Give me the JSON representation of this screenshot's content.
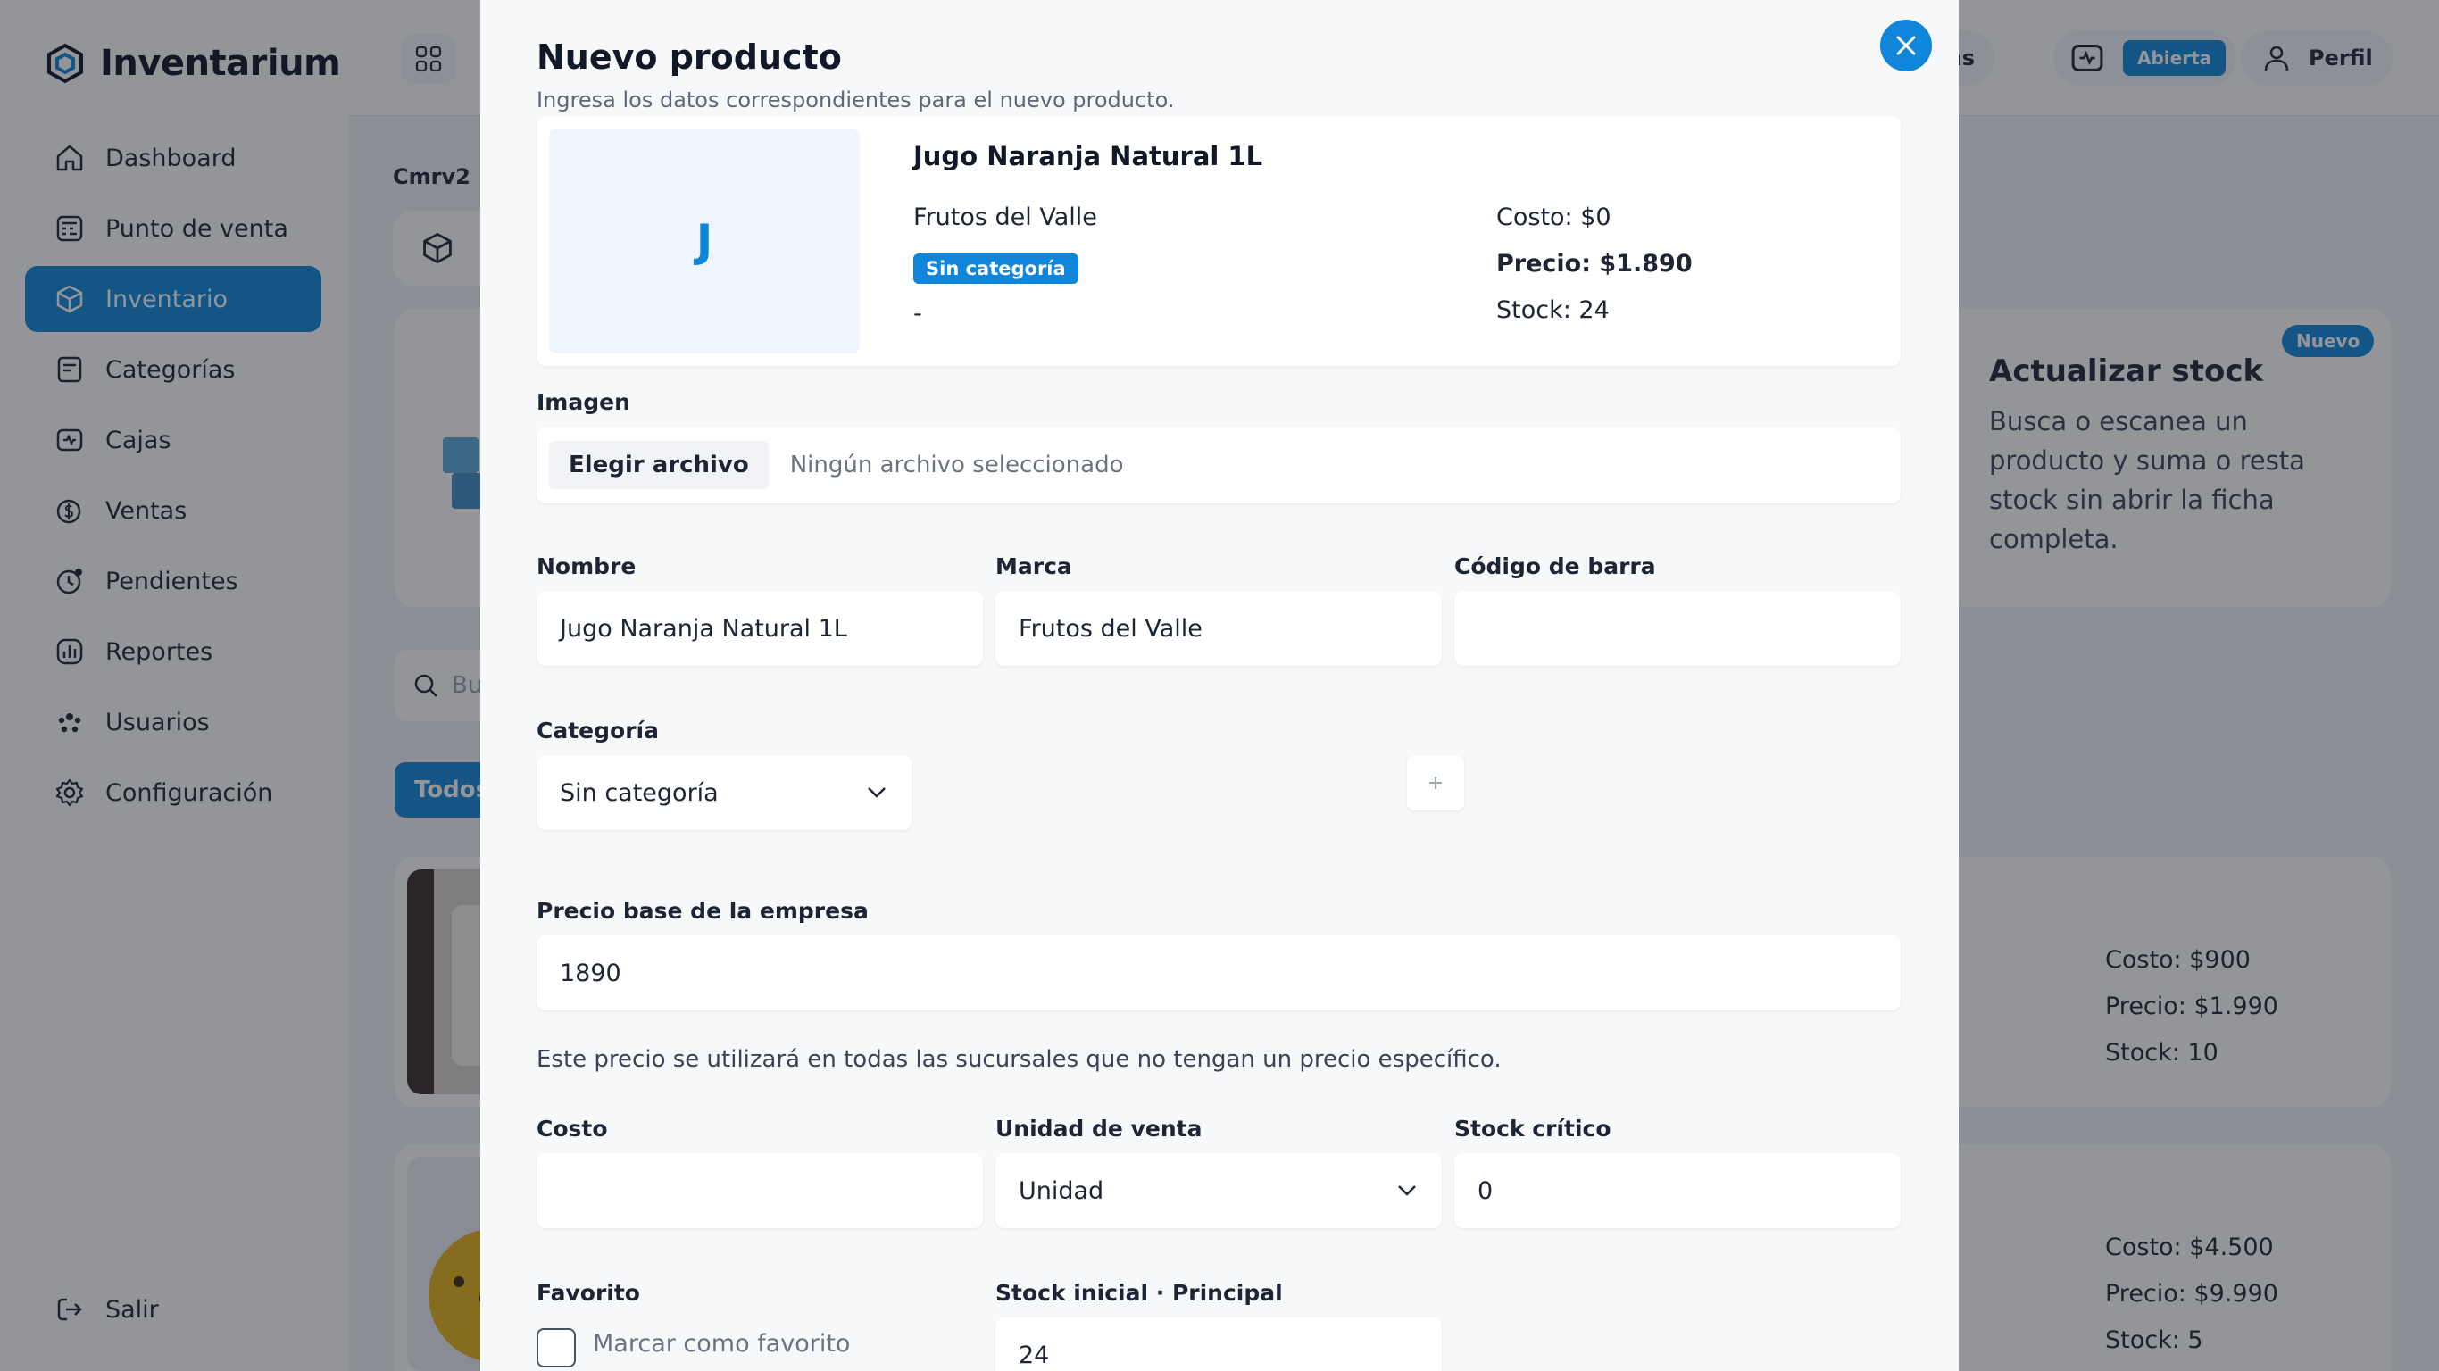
{
  "app": {
    "name": "Inventarium"
  },
  "sidebar": {
    "items": [
      {
        "label": "Dashboard",
        "icon": "home-icon"
      },
      {
        "label": "Punto de venta",
        "icon": "register-icon"
      },
      {
        "label": "Inventario",
        "icon": "box-icon",
        "active": true
      },
      {
        "label": "Categorías",
        "icon": "tag-icon"
      },
      {
        "label": "Cajas",
        "icon": "cash-box-icon"
      },
      {
        "label": "Ventas",
        "icon": "money-icon"
      },
      {
        "label": "Pendientes",
        "icon": "pending-icon"
      },
      {
        "label": "Reportes",
        "icon": "report-icon"
      },
      {
        "label": "Usuarios",
        "icon": "users-icon"
      },
      {
        "label": "Configuración",
        "icon": "gear-icon"
      }
    ],
    "logout": "Salir"
  },
  "topbar": {
    "alerts_label": "ertas",
    "cash_status": "Abierta",
    "profile_label": "Perfil"
  },
  "background": {
    "breadcrumb": "Cmrv2",
    "search_placeholder": "Bu",
    "tab_all": "Todos",
    "promo": {
      "badge": "Nuevo",
      "title": "Actualizar stock",
      "text": "Busca o escanea un producto y suma o resta stock sin abrir la ficha completa."
    },
    "products": [
      {
        "cost": "Costo: $900",
        "price": "Precio: $1.990",
        "stock": "Stock: 10"
      },
      {
        "cost": "Costo: $4.500",
        "price": "Precio: $9.990",
        "stock": "Stock: 5"
      }
    ]
  },
  "modal": {
    "title": "Nuevo producto",
    "subtitle": "Ingresa los datos correspondientes para el nuevo producto.",
    "preview": {
      "initial": "J",
      "name": "Jugo Naranja Natural 1L",
      "brand": "Frutos del Valle",
      "category": "Sin categoría",
      "dash": "-",
      "cost": "Costo: $0",
      "price": "Precio: $1.890",
      "stock": "Stock: 24"
    },
    "image": {
      "label": "Imagen",
      "button": "Elegir archivo",
      "status": "Ningún archivo seleccionado"
    },
    "name": {
      "label": "Nombre",
      "value": "Jugo Naranja Natural 1L"
    },
    "brand": {
      "label": "Marca",
      "value": "Frutos del Valle"
    },
    "barcode": {
      "label": "Código de barra",
      "value": ""
    },
    "category": {
      "label": "Categoría",
      "value": "Sin categoría",
      "add": "+"
    },
    "base_price": {
      "label": "Precio base de la empresa",
      "value": "1890",
      "help": "Este precio se utilizará en todas las sucursales que no tengan un precio específico."
    },
    "cost": {
      "label": "Costo",
      "value": ""
    },
    "unit": {
      "label": "Unidad de venta",
      "value": "Unidad"
    },
    "critical_stock": {
      "label": "Stock crítico",
      "value": "0"
    },
    "favorite": {
      "label": "Favorito",
      "checkbox_label": "Marcar como favorito"
    },
    "initial_stock": {
      "label": "Stock inicial · Principal",
      "value": "24"
    }
  },
  "colors": {
    "accent": "#0f86d9"
  }
}
